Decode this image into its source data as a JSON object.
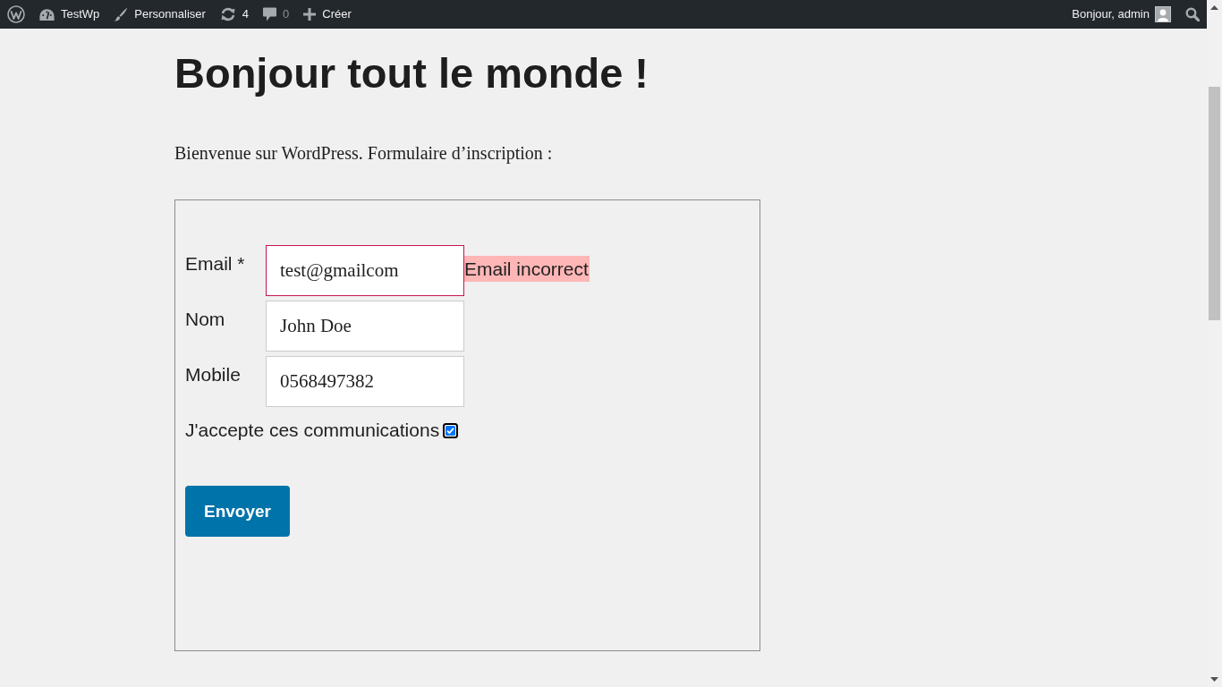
{
  "admin_bar": {
    "items": [
      {
        "kind": "logo"
      },
      {
        "kind": "site",
        "label": "TestWp"
      },
      {
        "kind": "customize",
        "label": "Personnaliser"
      },
      {
        "kind": "updates",
        "label": "4"
      },
      {
        "kind": "comments",
        "label": "0"
      },
      {
        "kind": "new",
        "label": "Créer"
      }
    ],
    "greeting": "Bonjour, admin"
  },
  "post": {
    "title": "Bonjour tout le monde !",
    "intro": "Bienvenue sur WordPress. Formulaire d’inscription :"
  },
  "form": {
    "fields": [
      {
        "label": "Email *",
        "value": "test@gmailcom",
        "invalid": true,
        "error": "Email incorrect"
      },
      {
        "label": "Nom",
        "value": "John Doe",
        "invalid": false
      },
      {
        "label": "Mobile",
        "value": "0568497382",
        "invalid": false
      }
    ],
    "consent": {
      "label": "J'accepte ces communications",
      "checked": true
    },
    "submit": "Envoyer"
  }
}
